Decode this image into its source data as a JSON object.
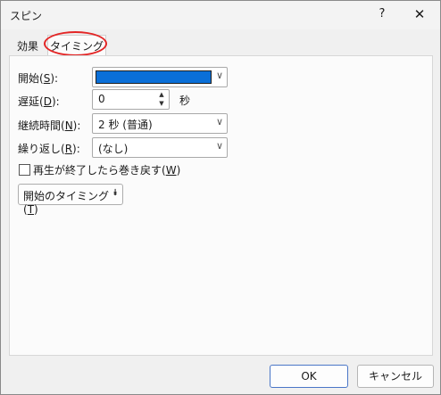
{
  "window": {
    "title": "スピン",
    "help_label": "?",
    "close_label": "✕"
  },
  "tabs": [
    {
      "label": "効果"
    },
    {
      "label": "タイミング"
    }
  ],
  "fields": {
    "start": {
      "label_prefix": "開始(",
      "key": "S",
      "label_suffix": "):"
    },
    "delay": {
      "label_prefix": "遅延(",
      "key": "D",
      "label_suffix": "):",
      "value": "0",
      "unit": "秒"
    },
    "duration": {
      "label_prefix": "継続時間(",
      "key": "N",
      "label_suffix": "):",
      "value": "2 秒 (普通)"
    },
    "repeat": {
      "label_prefix": "繰り返し(",
      "key": "R",
      "label_suffix": "):",
      "value": "(なし)"
    }
  },
  "rewind": {
    "label_prefix": "再生が終了したら巻き戻す(",
    "key": "W",
    "label_suffix": ")",
    "checked": false
  },
  "triggers_button": {
    "label_prefix": "開始のタイミング(",
    "key": "T",
    "label_suffix": ")"
  },
  "buttons": {
    "ok": "OK",
    "cancel": "キャンセル"
  },
  "colors": {
    "start_swatch": "#0a6fd8",
    "highlight": "#e32626"
  },
  "icons": {
    "combo_arrow": "chevron-down-icon",
    "spin_up": "triangle-up-icon",
    "spin_down": "triangle-down-icon",
    "triggers": "double-chevron-down-icon"
  }
}
